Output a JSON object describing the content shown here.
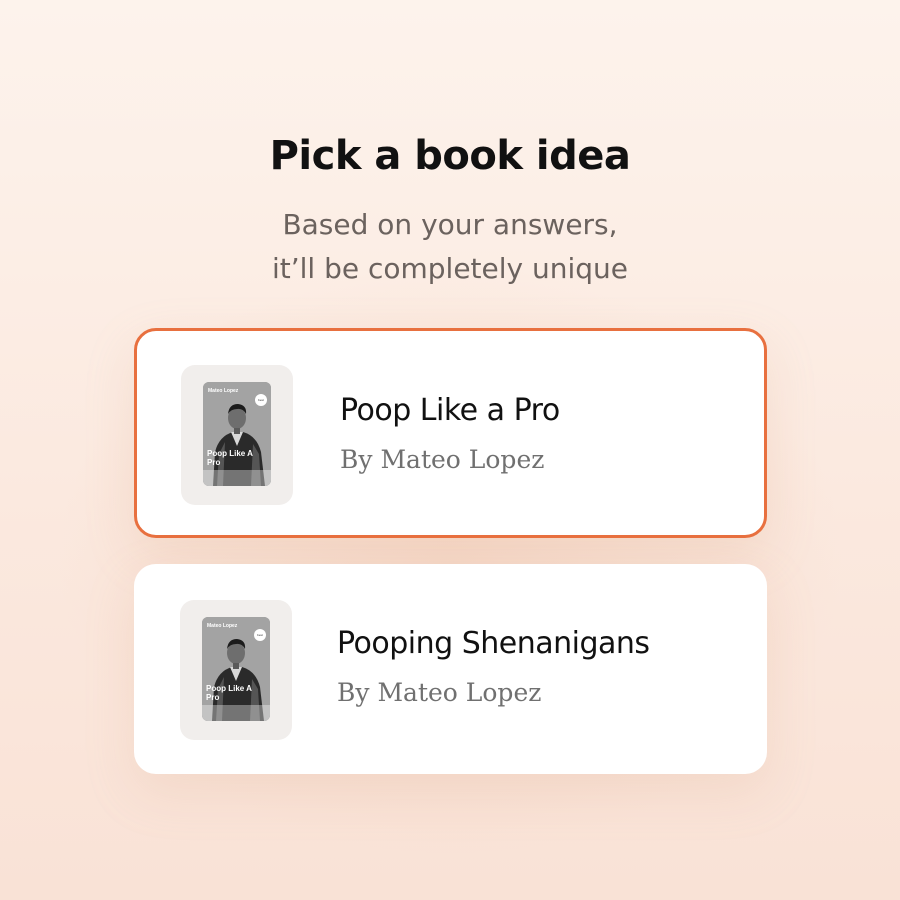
{
  "header": {
    "title": "Pick a book idea",
    "subtitle_line1": "Based on your answers,",
    "subtitle_line2": "it’ll be completely unique"
  },
  "books": [
    {
      "title": "Poop Like a Pro",
      "author": "By Mateo Lopez",
      "selected": true,
      "cover": {
        "author": "Mateo Lopez",
        "title": "Poop Like A Pro",
        "badge": "best seller"
      }
    },
    {
      "title": "Pooping Shenanigans",
      "author": "By Mateo Lopez",
      "selected": false,
      "cover": {
        "author": "Mateo Lopez",
        "title": "Poop Like A Pro",
        "badge": "best seller"
      }
    }
  ],
  "colors": {
    "accent": "#e8703f",
    "background": "#fcefe6",
    "card": "#ffffff",
    "title_text": "#111111",
    "subtitle_text": "#6b625e",
    "author_text": "#707070"
  }
}
